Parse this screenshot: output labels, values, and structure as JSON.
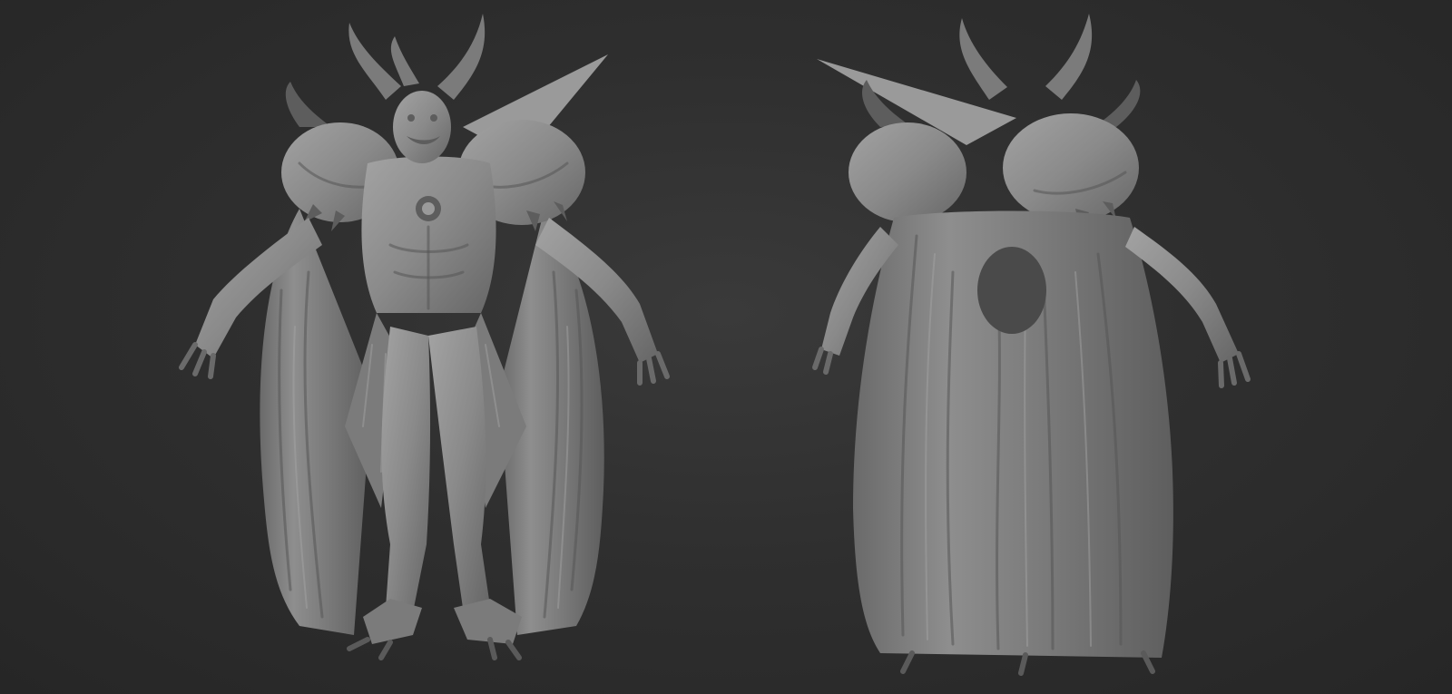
{
  "scene": {
    "background_color": "#2f2f2f",
    "clay_color": "#8a8a8a",
    "views": [
      {
        "name": "front-view"
      },
      {
        "name": "back-view"
      }
    ]
  }
}
